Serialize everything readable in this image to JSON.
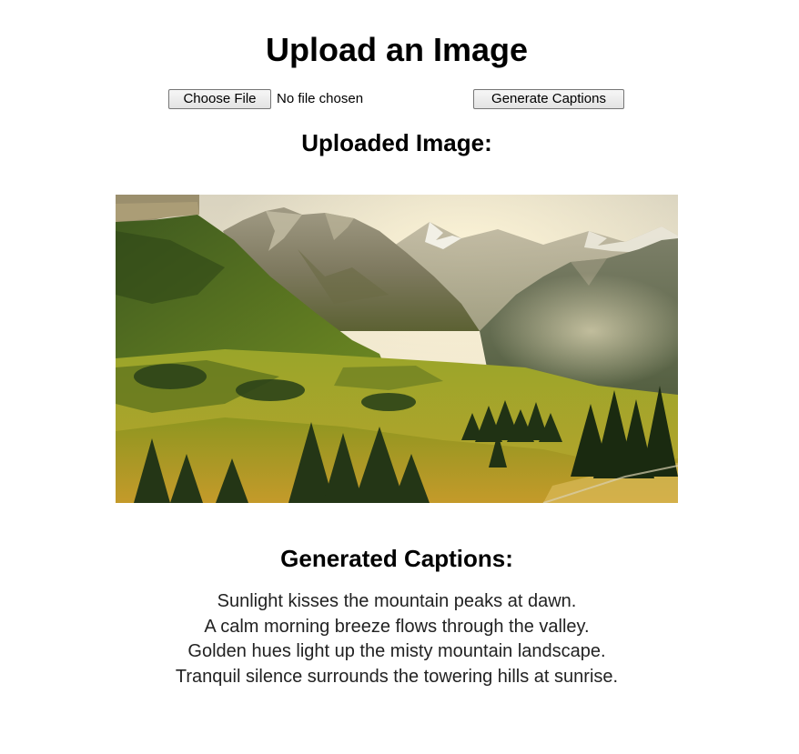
{
  "page": {
    "title": "Upload an Image"
  },
  "upload": {
    "choose_file_label": "Choose File",
    "file_status": "No file chosen",
    "generate_label": "Generate Captions"
  },
  "uploaded": {
    "heading": "Uploaded Image:",
    "image_alt_icon": "mountain-landscape-photo"
  },
  "captions": {
    "heading": "Generated Captions:",
    "lines": [
      "Sunlight kisses the mountain peaks at dawn.",
      "A calm morning breeze flows through the valley.",
      "Golden hues light up the misty mountain landscape.",
      "Tranquil silence surrounds the towering hills at sunrise."
    ]
  },
  "colors": {
    "background": "#ffffff",
    "text": "#000000",
    "caption_text": "#222222",
    "button_border": "#767676"
  }
}
